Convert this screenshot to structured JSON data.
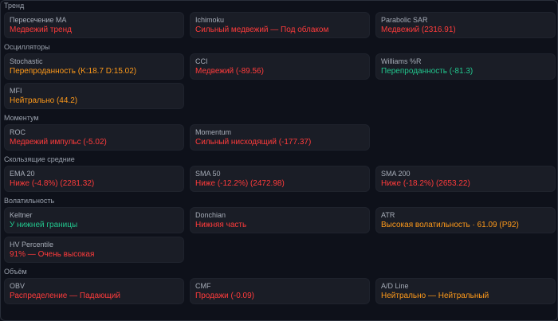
{
  "colors": {
    "red": "#ff3b3b",
    "orange": "#ff9a1a",
    "green": "#22c78e"
  },
  "sections": [
    {
      "title": "Тренд",
      "cards": [
        {
          "label": "Пересечение МА",
          "value": "Медвежий тренд",
          "status": "red"
        },
        {
          "label": "Ichimoku",
          "value": "Сильный медвежий — Под облаком",
          "status": "red"
        },
        {
          "label": "Parabolic SAR",
          "value": "Медвежий (2316.91)",
          "status": "red"
        }
      ]
    },
    {
      "title": "Осцилляторы",
      "cards": [
        {
          "label": "Stochastic",
          "value": "Перепроданность (K:18.7 D:15.02)",
          "status": "orange"
        },
        {
          "label": "CCI",
          "value": "Медвежий (-89.56)",
          "status": "red"
        },
        {
          "label": "Williams %R",
          "value": "Перепроданность (-81.3)",
          "status": "green"
        },
        {
          "label": "MFI",
          "value": "Нейтрально (44.2)",
          "status": "orange"
        }
      ]
    },
    {
      "title": "Моментум",
      "cards": [
        {
          "label": "ROC",
          "value": "Медвежий импульс (-5.02)",
          "status": "red"
        },
        {
          "label": "Momentum",
          "value": "Сильный нисходящий (-177.37)",
          "status": "red"
        }
      ]
    },
    {
      "title": "Скользящие средние",
      "cards": [
        {
          "label": "EMA 20",
          "value": "Ниже (-4.8%) (2281.32)",
          "status": "red"
        },
        {
          "label": "SMA 50",
          "value": "Ниже (-12.2%) (2472.98)",
          "status": "red"
        },
        {
          "label": "SMA 200",
          "value": "Ниже (-18.2%) (2653.22)",
          "status": "red"
        }
      ]
    },
    {
      "title": "Волатильность",
      "cards": [
        {
          "label": "Keltner",
          "value": "У нижней границы",
          "status": "green"
        },
        {
          "label": "Donchian",
          "value": "Нижняя часть",
          "status": "red"
        },
        {
          "label": "ATR",
          "value": "Высокая волатильность · 61.09 (P92)",
          "status": "orange"
        },
        {
          "label": "HV Percentile",
          "value": "91% — Очень высокая",
          "status": "red"
        }
      ]
    },
    {
      "title": "Объём",
      "cards": [
        {
          "label": "OBV",
          "value": "Распределение — Падающий",
          "status": "red"
        },
        {
          "label": "CMF",
          "value": "Продажи (-0.09)",
          "status": "red"
        },
        {
          "label": "A/D Line",
          "value": "Нейтрально — Нейтральный",
          "status": "orange"
        }
      ]
    }
  ]
}
